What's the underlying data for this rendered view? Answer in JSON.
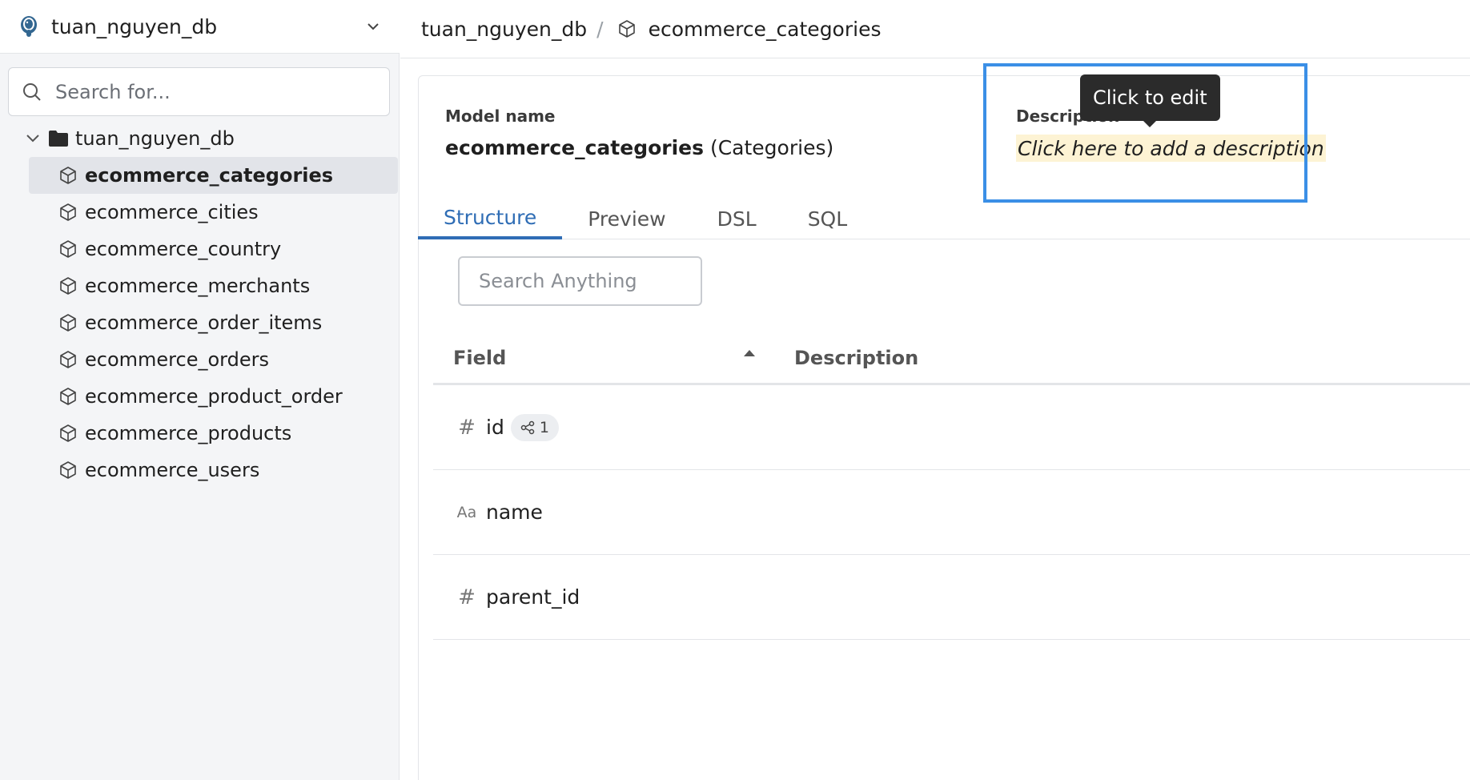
{
  "sidebar": {
    "db_name": "tuan_nguyen_db",
    "search_placeholder": "Search for...",
    "tree_root": "tuan_nguyen_db",
    "items": [
      {
        "label": "ecommerce_categories",
        "active": true
      },
      {
        "label": "ecommerce_cities"
      },
      {
        "label": "ecommerce_country"
      },
      {
        "label": "ecommerce_merchants"
      },
      {
        "label": "ecommerce_order_items"
      },
      {
        "label": "ecommerce_orders"
      },
      {
        "label": "ecommerce_product_order"
      },
      {
        "label": "ecommerce_products"
      },
      {
        "label": "ecommerce_users"
      }
    ]
  },
  "header": {
    "crumb_db": "tuan_nguyen_db",
    "crumb_sep": "/",
    "crumb_model": "ecommerce_categories"
  },
  "model": {
    "name_label": "Model name",
    "name": "ecommerce_categories",
    "alias": "(Categories)",
    "description_label": "Description",
    "description_placeholder": "Click here to add a description",
    "tooltip": "Click to edit"
  },
  "tabs": [
    {
      "label": "Structure",
      "active": true
    },
    {
      "label": "Preview"
    },
    {
      "label": "DSL"
    },
    {
      "label": "SQL"
    }
  ],
  "structure": {
    "search_placeholder": "Search Anything",
    "columns": {
      "field": "Field",
      "description": "Description"
    },
    "rows": [
      {
        "type_icon": "#",
        "name": "id",
        "relations": "1"
      },
      {
        "type_icon": "Aa",
        "name": "name"
      },
      {
        "type_icon": "#",
        "name": "parent_id"
      }
    ]
  },
  "colors": {
    "accent": "#2f6db5",
    "highlight_box": "#3b8fe6",
    "description_bg": "#fdf3d4"
  }
}
